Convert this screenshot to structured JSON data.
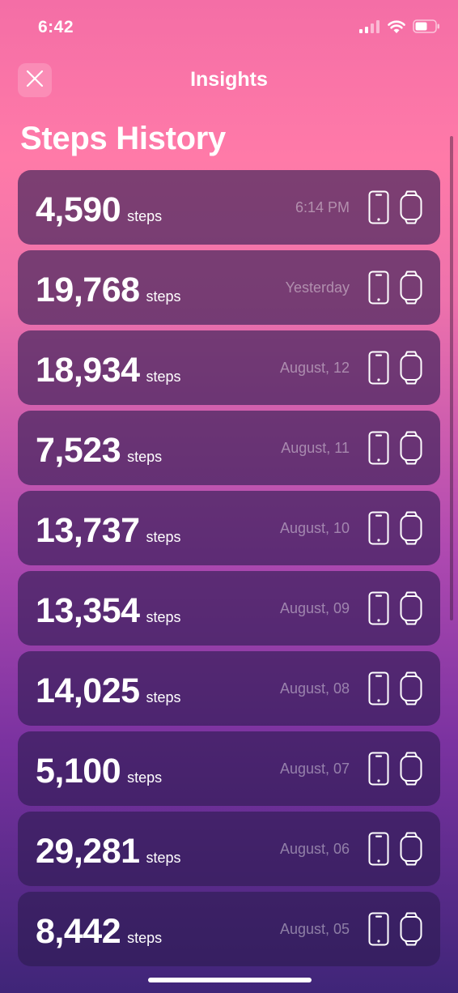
{
  "status_bar": {
    "time": "6:42",
    "icons": [
      "cellular-signal-icon",
      "wifi-icon",
      "battery-icon"
    ]
  },
  "nav": {
    "close_icon": "close-icon",
    "title": "Insights"
  },
  "page_title": "Steps History",
  "history": [
    {
      "count": "4,590",
      "unit": "steps",
      "date": "6:14 PM"
    },
    {
      "count": "19,768",
      "unit": "steps",
      "date": "Yesterday"
    },
    {
      "count": "18,934",
      "unit": "steps",
      "date": "August, 12"
    },
    {
      "count": "7,523",
      "unit": "steps",
      "date": "August, 11"
    },
    {
      "count": "13,737",
      "unit": "steps",
      "date": "August, 10"
    },
    {
      "count": "13,354",
      "unit": "steps",
      "date": "August, 09"
    },
    {
      "count": "14,025",
      "unit": "steps",
      "date": "August, 08"
    },
    {
      "count": "5,100",
      "unit": "steps",
      "date": "August, 07"
    },
    {
      "count": "29,281",
      "unit": "steps",
      "date": "August, 06"
    },
    {
      "count": "8,442",
      "unit": "steps",
      "date": "August, 05"
    }
  ],
  "row_icons": [
    "phone-icon",
    "watch-icon"
  ],
  "colors": {
    "gradient_top": "#f46ea6",
    "gradient_bottom": "#3f2578",
    "card_bg": "#2d1b50"
  }
}
